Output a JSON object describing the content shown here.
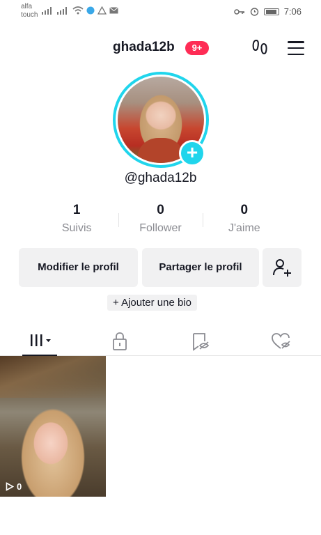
{
  "status_bar": {
    "carrier_line1": "alfa",
    "carrier_line2": "touch",
    "time": "7:06"
  },
  "header": {
    "username": "ghada12b",
    "notification_count": "9+",
    "icons": [
      "footsteps-icon",
      "menu-icon"
    ]
  },
  "profile": {
    "handle": "@ghada12b",
    "add_avatar_symbol": "+"
  },
  "stats": [
    {
      "value": "1",
      "label": "Suivis"
    },
    {
      "value": "0",
      "label": "Follower"
    },
    {
      "value": "0",
      "label": "J'aime"
    }
  ],
  "actions": {
    "edit_profile": "Modifier le profil",
    "share_profile": "Partager le profil",
    "add_bio": "+ Ajouter une bio"
  },
  "tabs": [
    "videos-grid-tab",
    "private-tab",
    "reposts-tab",
    "liked-tab"
  ],
  "videos": [
    {
      "views": "0"
    }
  ],
  "colors": {
    "accent_cyan": "#20d5ec",
    "badge_red": "#fe2c55",
    "button_bg": "#f1f1f2"
  }
}
